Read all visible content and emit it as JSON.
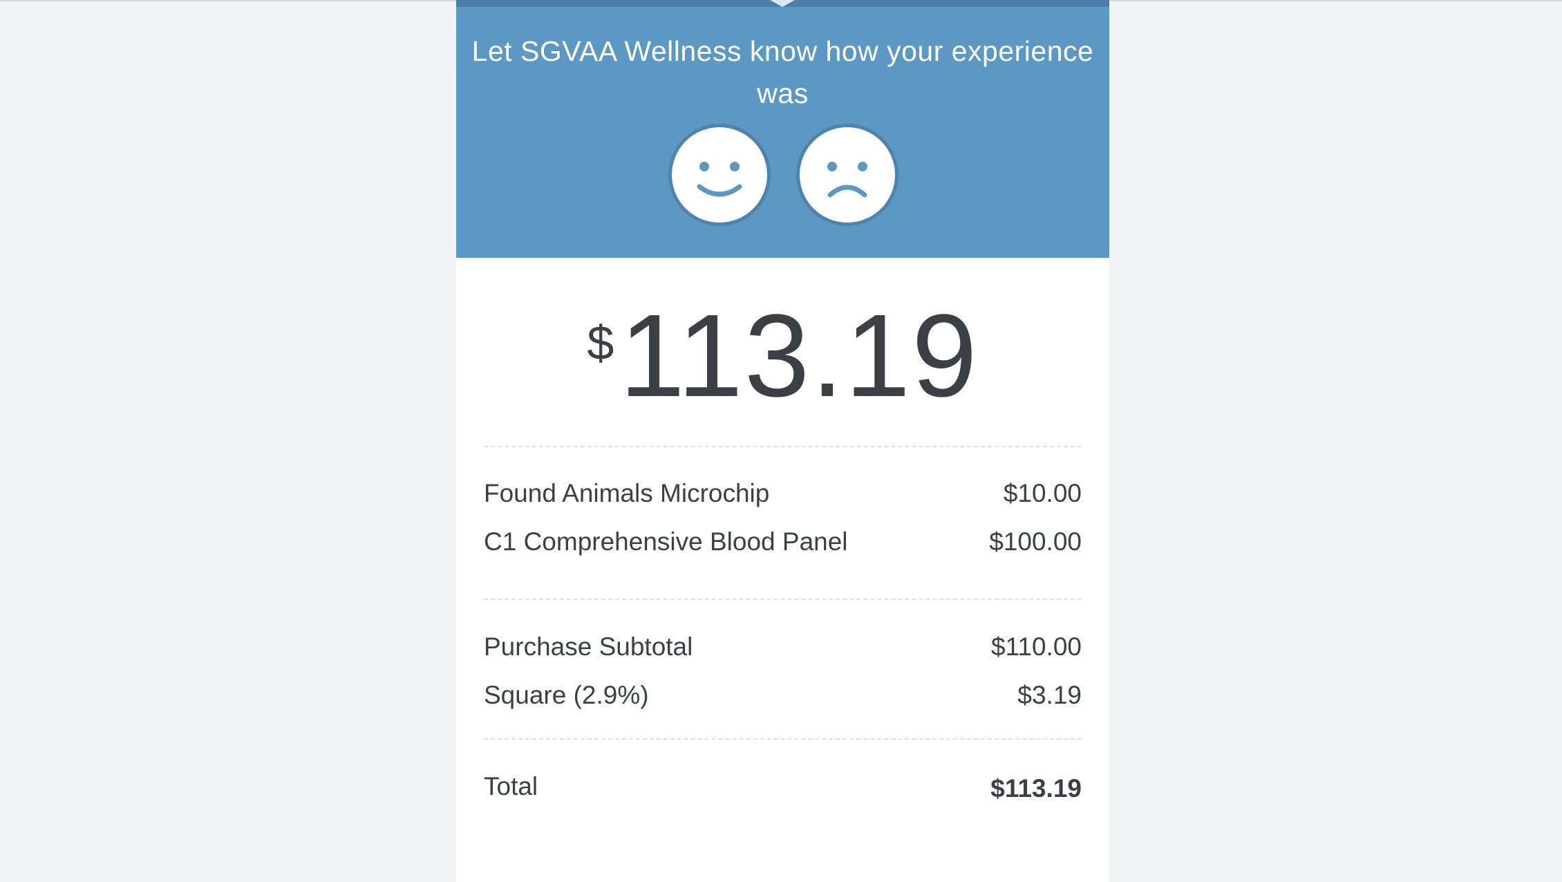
{
  "feedback": {
    "prompt": "Let SGVAA Wellness know how your experience was",
    "positive_icon": "smiley-face-icon",
    "negative_icon": "frown-face-icon",
    "colors": {
      "banner": "#5b98c4",
      "icon_stroke": "#5b98c4"
    }
  },
  "amount": {
    "currency_symbol": "$",
    "value": "113.19"
  },
  "line_items": [
    {
      "name": "Found Animals Microchip",
      "price": "$10.00"
    },
    {
      "name": "C1 Comprehensive Blood Panel",
      "price": "$100.00"
    }
  ],
  "summary": [
    {
      "name": "Purchase Subtotal",
      "price": "$110.00"
    },
    {
      "name": "Square (2.9%)",
      "price": "$3.19"
    }
  ],
  "total": {
    "label": "Total",
    "price": "$113.19"
  }
}
